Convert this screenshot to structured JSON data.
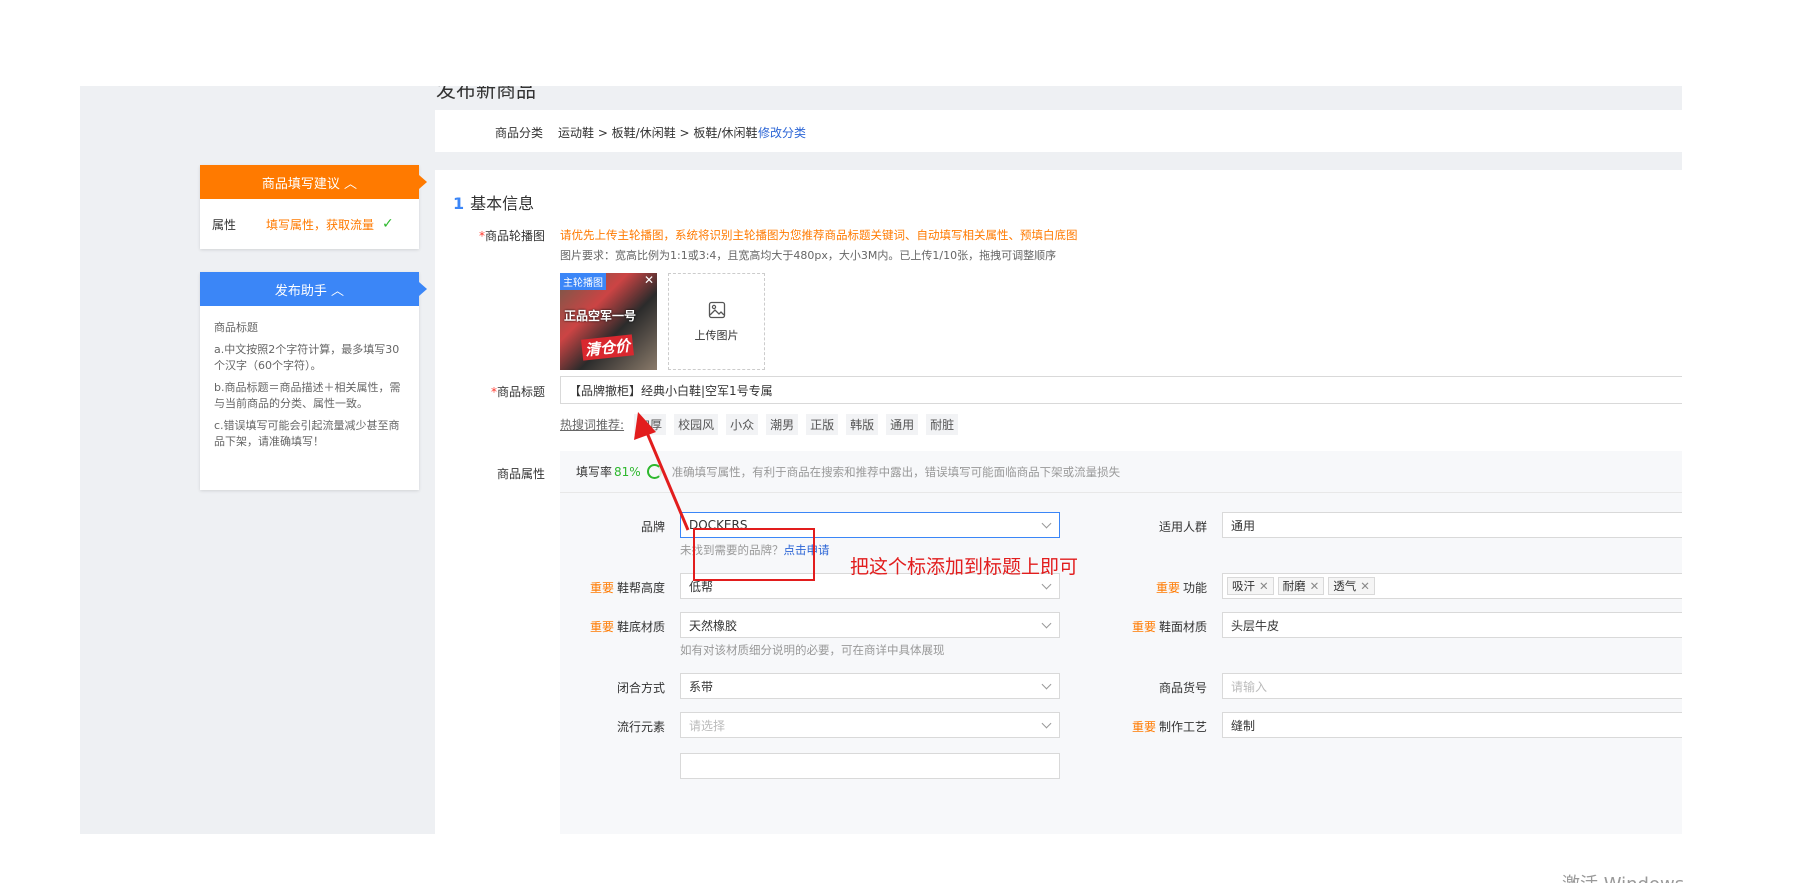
{
  "page_heading": "发布新商品",
  "category": {
    "label": "商品分类",
    "path": "运动鞋 > 板鞋/休闲鞋 > 板鞋/休闲鞋",
    "edit_label": "修改分类"
  },
  "tips_panel": {
    "title": "商品填写建议 ︿",
    "row_label": "属性",
    "row_value": "填写属性，获取流量",
    "check": "✓"
  },
  "helper_panel": {
    "title": "发布助手 ︿",
    "lines": [
      "商品标题",
      "a.中文按照2个字符计算，最多填写30个汉字（60个字符）。",
      "b.商品标题＝商品描述＋相关属性，需与当前商品的分类、属性一致。",
      "c.错误填写可能会引起流量减少甚至商品下架，请准确填写！"
    ]
  },
  "section": {
    "num": "1",
    "title": "基本信息"
  },
  "images": {
    "label": "商品轮播图",
    "tip_main": "请优先上传主轮播图，系统将识别主轮播图为您推荐商品标题关键词、自动填写相关属性、预填白底图",
    "tip_req": "图片要求：宽高比例为1:1或3:4，且宽高均大于480px，大小3M内。已上传1/10张，拖拽可调整顺序",
    "thumb_badge": "主轮播图",
    "thumb_text": "正品空军一号",
    "thumb_price": "清仓价",
    "upload_label": "上传图片"
  },
  "title_field": {
    "label": "商品标题",
    "value": "【品牌撤柜】经典小白鞋|空军1号专属"
  },
  "hot_words": {
    "label": "热搜词推荐:",
    "items": [
      "加厚",
      "校园风",
      "小众",
      "潮男",
      "正版",
      "韩版",
      "通用",
      "耐脏"
    ]
  },
  "attributes": {
    "label": "商品属性",
    "rate_label": "填写率",
    "rate_value": "81%",
    "note": "准确填写属性，有利于商品在搜索和推荐中露出，错误填写可能面临商品下架或流量损失",
    "brand": {
      "label": "品牌",
      "value": "DOCKERS",
      "hint": "未找到需要的品牌？",
      "hint_link": "点击申请"
    },
    "people": {
      "label": "适用人群",
      "value": "通用"
    },
    "important": "重要",
    "upper_height": {
      "label": "鞋帮高度",
      "value": "低帮"
    },
    "function": {
      "label": "功能",
      "chips": [
        "吸汗",
        "耐磨",
        "透气"
      ]
    },
    "sole": {
      "label": "鞋底材质",
      "value": "天然橡胶",
      "hint": "如有对该材质细分说明的必要，可在商详中具体展现"
    },
    "upper_material": {
      "label": "鞋面材质",
      "value": "头层牛皮"
    },
    "closure": {
      "label": "闭合方式",
      "value": "系带"
    },
    "item_no": {
      "label": "商品货号",
      "placeholder": "请输入"
    },
    "style": {
      "label": "流行元素",
      "placeholder": "请选择"
    },
    "craft": {
      "label": "制作工艺",
      "value": "缝制"
    }
  },
  "annotation": {
    "text": "把这个标添加到标题上即可",
    "color": "#e21d1d"
  },
  "watermark": "激活 Windows"
}
